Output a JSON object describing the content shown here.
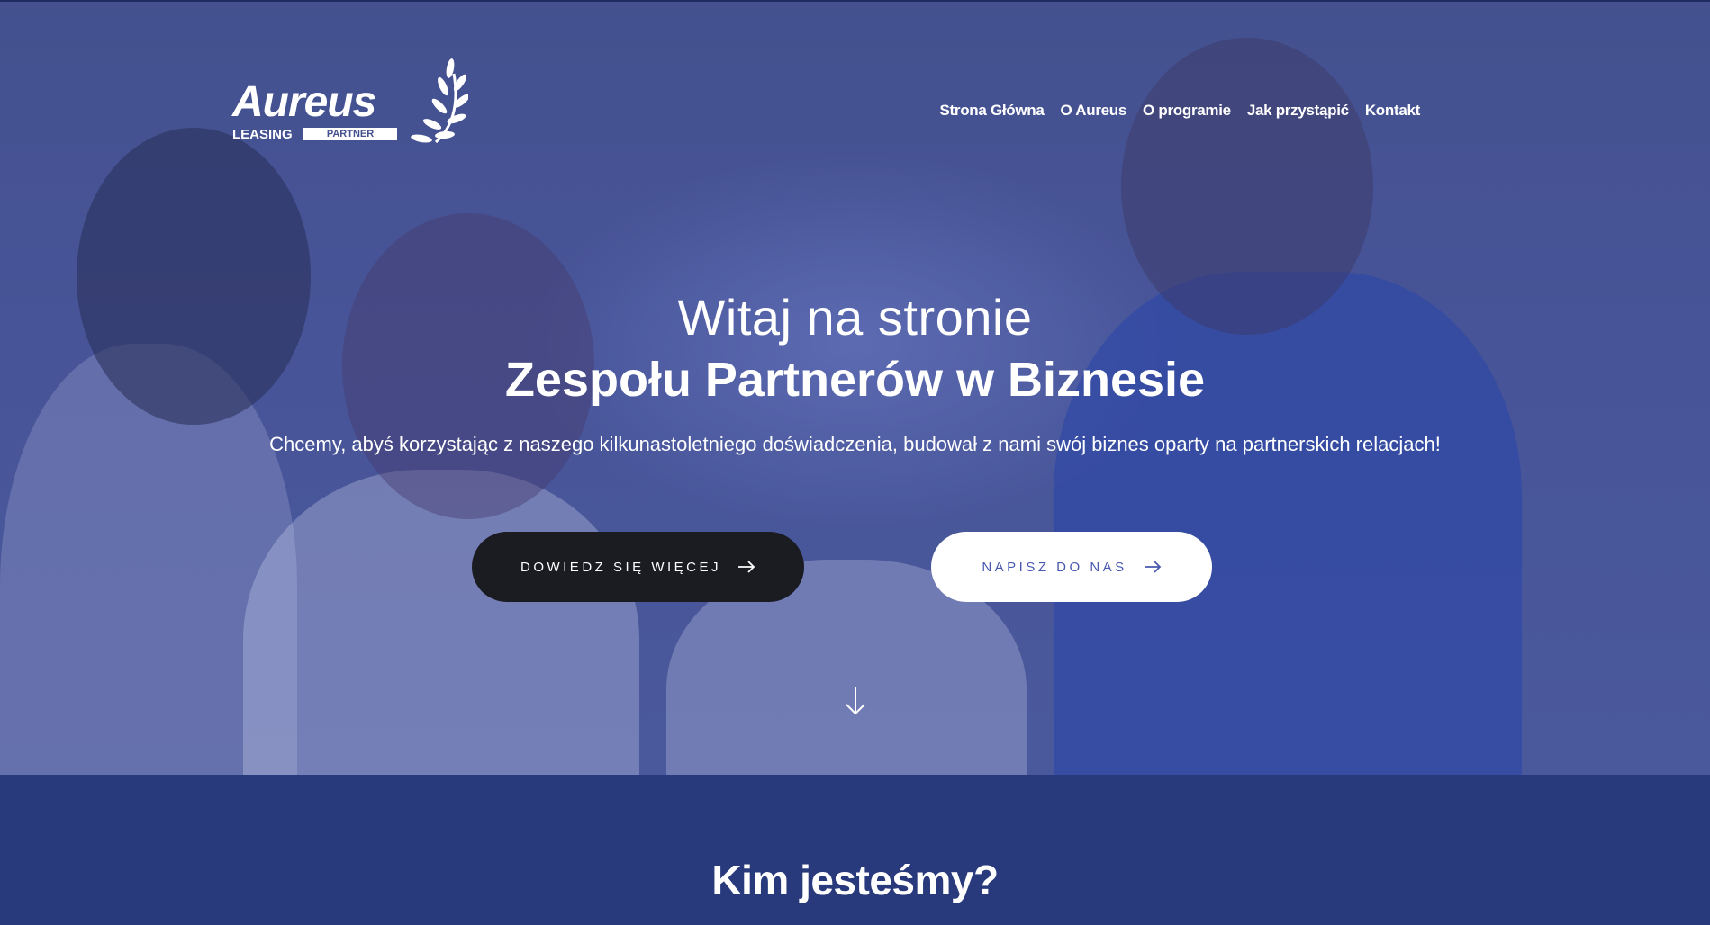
{
  "logo": {
    "word": "Aureus",
    "leasing": "LEASING",
    "partner": "PARTNER"
  },
  "nav": {
    "items": [
      {
        "label": "Strona Główna"
      },
      {
        "label": "O Aureus"
      },
      {
        "label": "O programie"
      },
      {
        "label": "Jak przystąpić"
      },
      {
        "label": "Kontakt"
      }
    ]
  },
  "hero": {
    "title_line1": "Witaj na stronie",
    "title_line2": "Zespołu Partnerów w Biznesie",
    "subtitle": "Chcemy, abyś korzystając z naszego kilkunastoletniego doświadczenia, budował z nami swój biznes oparty na partnerskich relacjach!",
    "primary_button": "DOWIEDZ SIĘ WIĘCEJ",
    "secondary_button": "NAPISZ DO NAS",
    "icons": {
      "button_arrow": "arrow-right-icon",
      "scroll": "arrow-down-icon"
    }
  },
  "section2": {
    "title": "Kim jesteśmy?"
  },
  "colors": {
    "hero_overlay": "#44518f",
    "section_bg": "#283a7c",
    "dark_button": "#1b1b22",
    "light_button_text": "#4a59b0",
    "text": "#ffffff"
  }
}
